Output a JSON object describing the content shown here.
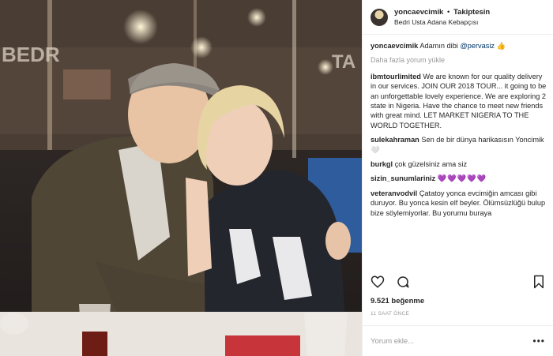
{
  "post": {
    "username": "yoncaevcimik",
    "separator": "•",
    "follow_status": "Takiptesin",
    "location": "Bedri Usta Adana Kebapçısı"
  },
  "photo": {
    "sign_left": "BEDR",
    "sign_right": "TA"
  },
  "caption": {
    "username": "yoncaevcimik",
    "text": "Adamın dibi",
    "mention": "@pervasiz",
    "emoji": "👍"
  },
  "load_more": "Daha fazla yorum yükle",
  "comments": [
    {
      "user": "ibmtourlimited",
      "text": "We are known for our quality delivery in our services. JOIN OUR 2018 TOUR... it going to be an unforgettable lovely experience. We are exploring 2 state in Nigeria. Have the chance to meet new friends with great mind. LET MARKET NIGERIA TO THE WORLD TOGETHER."
    },
    {
      "user": "sulekahraman",
      "text": "Sen de bir dünya harikasısın Yoncimik 🤍"
    },
    {
      "user": "burkgl",
      "text": "çok güzelsiniz ama siz"
    },
    {
      "user": "sizin_sunumlariniz",
      "text": "💜💜💜💜💜"
    },
    {
      "user": "veteranvodvil",
      "text": "Çatatoy yonca evcimiğin amcası gibi duruyor. Bu yonca kesin elf beyler. Ölümsüzlüğü bulup bize söylemiyorlar. Bu yorumu buraya"
    }
  ],
  "icons": {
    "like": "heart-icon",
    "comment": "comment-icon",
    "save": "bookmark-icon",
    "more": "more-icon"
  },
  "likes_count": "9.521 beğenme",
  "time_ago": "11 SAAT ÖNCE",
  "add_comment_placeholder": "Yorum ekle...",
  "more_options": "•••",
  "colors": {
    "mention": "#003569",
    "muted": "#999999",
    "border": "#efefef"
  }
}
